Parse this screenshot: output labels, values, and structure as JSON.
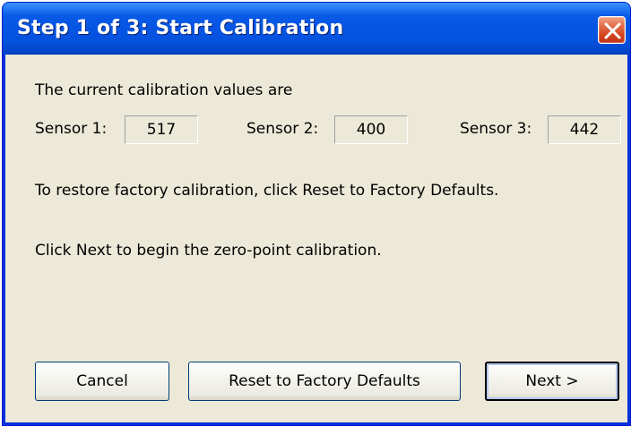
{
  "window": {
    "title": "Step 1 of 3: Start Calibration"
  },
  "intro_text": "The current calibration values are",
  "sensors": [
    {
      "label": "Sensor 1:",
      "value": "517"
    },
    {
      "label": "Sensor 2:",
      "value": "400"
    },
    {
      "label": "Sensor 3:",
      "value": "442"
    }
  ],
  "restore_text": "To restore factory calibration, click Reset to Factory Defaults.",
  "next_text": "Click Next to begin the zero-point calibration.",
  "buttons": {
    "cancel": "Cancel",
    "reset": "Reset to Factory Defaults",
    "next": "Next >"
  },
  "colors": {
    "titlebar": "#0554e3",
    "client_background": "#ece9d8",
    "close_button": "#d4421c"
  },
  "icons": {
    "close": "close-icon"
  }
}
